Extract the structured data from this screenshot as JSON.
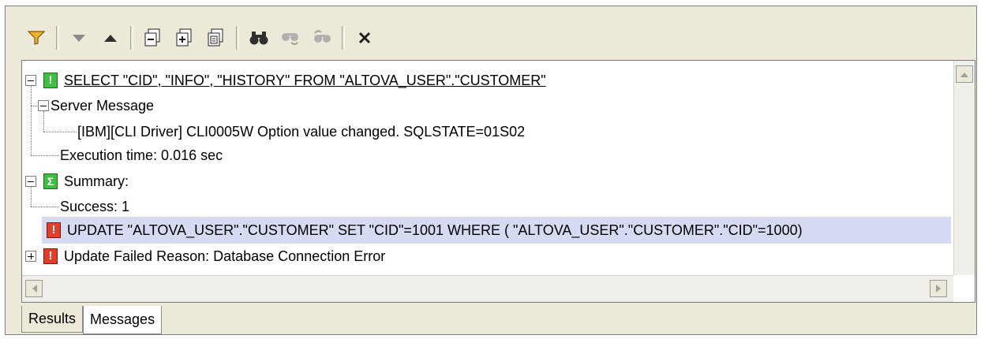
{
  "toolbar": {
    "buttons": [
      {
        "name": "filter-icon"
      },
      {
        "name": "arrow-down-icon"
      },
      {
        "name": "arrow-up-icon"
      },
      {
        "name": "collapse-all-icon"
      },
      {
        "name": "expand-all-icon"
      },
      {
        "name": "copy-icon"
      },
      {
        "name": "find-icon"
      },
      {
        "name": "find-next-icon"
      },
      {
        "name": "find-previous-icon"
      },
      {
        "name": "close-icon"
      }
    ]
  },
  "messages": {
    "select_query": "SELECT \"CID\", \"INFO\", \"HISTORY\" FROM \"ALTOVA_USER\".\"CUSTOMER\"",
    "server_message_label": "Server Message",
    "server_message_text": "[IBM][CLI Driver] CLI0005W  Option value changed. SQLSTATE=01S02",
    "execution_time": "Execution time: 0.016 sec",
    "summary_label": "Summary:",
    "success": "Success: 1",
    "update_query": "UPDATE \"ALTOVA_USER\".\"CUSTOMER\" SET \"CID\"=1001   WHERE (  \"ALTOVA_USER\".\"CUSTOMER\".\"CID\"=1000)",
    "update_failed": "Update Failed Reason: Database Connection Error"
  },
  "tabs": {
    "results": "Results",
    "messages": "Messages"
  },
  "colors": {
    "selection": "#d6daf2",
    "ok_icon": "#3fbf3f",
    "error_icon": "#e0402a"
  }
}
